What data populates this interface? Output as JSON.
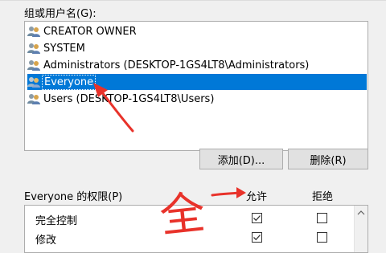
{
  "groups_label": "组或用户名(G):",
  "users": [
    {
      "name": "CREATOR OWNER",
      "selected": false
    },
    {
      "name": "SYSTEM",
      "selected": false
    },
    {
      "name": "Administrators (DESKTOP-1GS4LT8\\Administrators)",
      "selected": false
    },
    {
      "name": "Everyone",
      "selected": true
    },
    {
      "name": "Users (DESKTOP-1GS4LT8\\Users)",
      "selected": false
    }
  ],
  "buttons": {
    "add": "添加(D)...",
    "remove": "删除(R)"
  },
  "permissions": {
    "title": "Everyone 的权限(P)",
    "allow_header": "允许",
    "deny_header": "拒绝",
    "rows": [
      {
        "name": "完全控制",
        "allow": true,
        "deny": false
      },
      {
        "name": "修改",
        "allow": true,
        "deny": false
      }
    ]
  },
  "annotation": {
    "handwritten_text": "全",
    "color": "#e8322a"
  },
  "colors": {
    "selection": "#0078d7",
    "annotation": "#e8322a"
  }
}
